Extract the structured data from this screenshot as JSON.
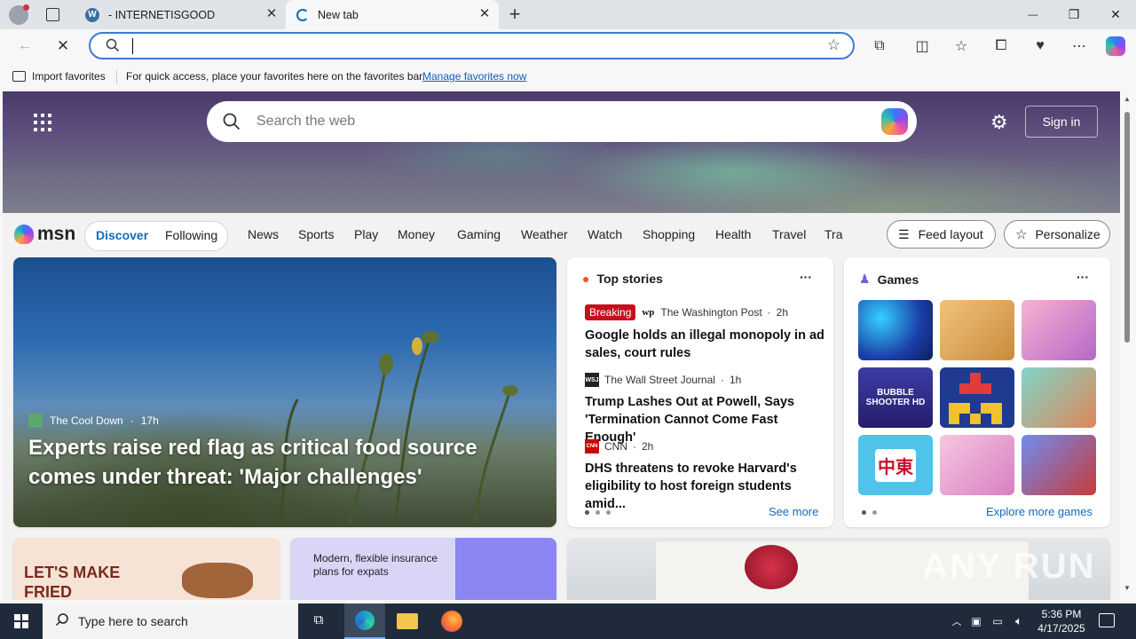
{
  "browser": {
    "tabs": [
      {
        "title": "- INTERNETISGOOD",
        "close": "✕"
      },
      {
        "title": "New tab",
        "close": "✕"
      }
    ],
    "new_tab": "+",
    "window_controls": {
      "minimize": "—",
      "maximize": "❐",
      "close": "✕"
    },
    "address_bar": {
      "value": "",
      "placeholder": ""
    },
    "favorites_bar": {
      "import_label": "Import favorites",
      "message": "For quick access, place your favorites here on the favorites bar.",
      "link": "Manage favorites now"
    }
  },
  "msn": {
    "search_placeholder": "Search the web",
    "sign_in": "Sign in",
    "logo": "msn",
    "nav_pill": [
      "Discover",
      "Following"
    ],
    "nav_items": [
      "News",
      "Sports",
      "Play",
      "Money",
      "Gaming",
      "Weather",
      "Watch",
      "Shopping",
      "Health",
      "Travel",
      "Tra"
    ],
    "feed_layout": "Feed layout",
    "personalize": "Personalize",
    "feature": {
      "source": "The Cool Down",
      "age": "17h",
      "headline": "Experts raise red flag as critical food source comes under threat: 'Major challenges'"
    },
    "top_stories": {
      "title": "Top stories",
      "more": "···",
      "items": [
        {
          "badge": "Breaking",
          "source": "The Washington Post",
          "age": "2h",
          "logo": "wp",
          "headline": "Google holds an illegal monopoly in ad sales, court rules"
        },
        {
          "source": "The Wall Street Journal",
          "age": "1h",
          "logo": "WSJ",
          "headline": "Trump Lashes Out at Powell, Says 'Termination Cannot Come Fast Enough'"
        },
        {
          "source": "CNN",
          "age": "2h",
          "logo": "CNN",
          "headline": "DHS threatens to revoke Harvard's eligibility to host foreign students amid..."
        }
      ],
      "see_more": "See more"
    },
    "games": {
      "title": "Games",
      "more": "···",
      "tiles": [
        "BUBBLE SHOOTER HD",
        "中東"
      ],
      "explore": "Explore more games"
    },
    "bottom_cards": {
      "left_text": "LET'S MAKE FRIED",
      "middle_text": "Modern, flexible insurance plans for expats"
    }
  },
  "taskbar": {
    "search_placeholder": "Type here to search",
    "time": "5:36 PM",
    "date": "4/17/2025"
  },
  "watermark": "ANY RUN",
  "colors": {
    "accent": "#0f6cbd",
    "breaking": "#c50f1f",
    "taskbar": "#1f2b3a"
  }
}
